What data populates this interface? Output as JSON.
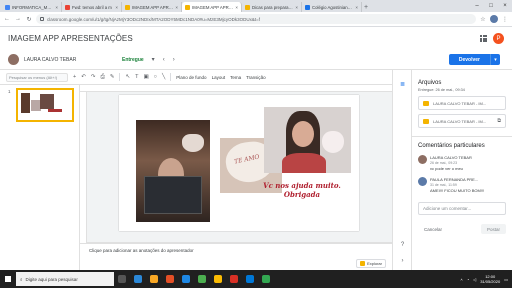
{
  "browser": {
    "tabs": [
      {
        "label": "INFORMATICA_MATER",
        "color": "#4285f4"
      },
      {
        "label": "Fwd: temos abril a m",
        "color": "#ea4335"
      },
      {
        "label": "IMAGEM APP APRESEN",
        "color": "#f4b400"
      },
      {
        "label": "IMAGEM APP APRESEN",
        "color": "#f4b400",
        "active": true
      },
      {
        "label": "Dicas para preparar p",
        "color": "#f4b400"
      },
      {
        "label": "Colégio Agostiniano S",
        "color": "#1a73e8"
      }
    ],
    "url": "classroom.google.com/u/1/g/tg/NjAzMjY3ODc2NDIx/MTA2ODY5MDc1NDA0#u=MzE3MjcyODk3ODUx&t=f"
  },
  "app": {
    "title": "IMAGEM APP APRESENTAÇÕES",
    "avatar_letter": "P"
  },
  "docbar": {
    "student": "LAURA CALVO TEBAR",
    "status": "Entregue",
    "return_label": "Devolver"
  },
  "toolbar": {
    "search_placeholder": "Pesquisar os menus (Alt+/)",
    "background": "Plano de fundo",
    "layout": "Layout",
    "theme": "Tema",
    "transition": "Transição"
  },
  "slide": {
    "number": "1",
    "heart_text": "TE AMO",
    "caption_line1": "Vc nos ajuda muito.",
    "caption_line2": "Obrigada"
  },
  "notes": {
    "placeholder": "Clique para adicionar as anotações do apresentador",
    "explore": "Explorar"
  },
  "panel": {
    "files_title": "Arquivos",
    "delivered": "Entregue: 26 de mai., 09:34",
    "files": [
      {
        "name": "LAURA CALVO TEBAR - IM..."
      },
      {
        "name": "LAURA CALVO TEBAR - IM..."
      }
    ],
    "comments_title": "Comentários particulares",
    "comments": [
      {
        "author": "LAURA CALVO TEBAR",
        "date": "26 de mai., 09:23",
        "text": "vc pode ver o meu",
        "color": "#8d6e63"
      },
      {
        "author": "PAULA FERNANDA PRE...",
        "date": "31 de mai., 11:59",
        "text": "AMEI!!! FICOU MUITO BOM!!!",
        "color": "#5b7aa8"
      }
    ],
    "add_comment": "Adicione um comentar...",
    "cancel": "Cancelar",
    "post": "Postar"
  },
  "taskbar": {
    "search": "Digite aqui para pesquisar",
    "time": "12:00",
    "date": "31/05/2020",
    "apps": [
      "#555555",
      "#2b88d8",
      "#f9a825",
      "#e34f26",
      "#1e88e5",
      "#4caf50",
      "#fbbc04",
      "#d93025",
      "#0078d7",
      "#33a852"
    ]
  }
}
